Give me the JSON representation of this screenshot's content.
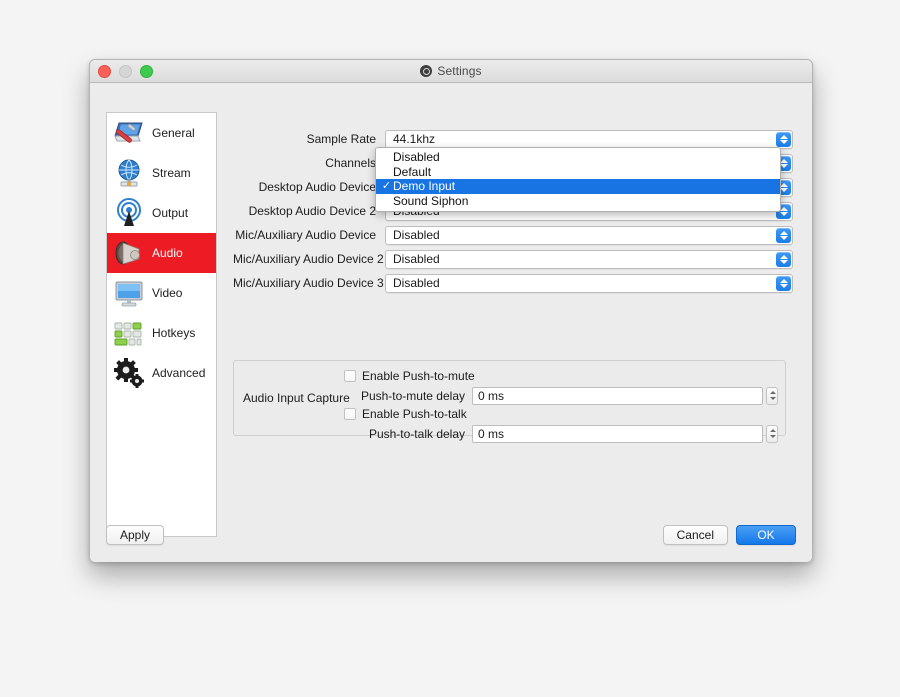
{
  "window": {
    "title": "Settings",
    "app_icon": "obs-icon",
    "traffic_lights": {
      "close": "close-button",
      "minimize": "minimize-button",
      "maximize": "maximize-button"
    }
  },
  "sidebar": {
    "items": [
      {
        "label": "General",
        "icon": "general-icon",
        "selected": false
      },
      {
        "label": "Stream",
        "icon": "stream-icon",
        "selected": false
      },
      {
        "label": "Output",
        "icon": "output-icon",
        "selected": false
      },
      {
        "label": "Audio",
        "icon": "audio-icon",
        "selected": true
      },
      {
        "label": "Video",
        "icon": "video-icon",
        "selected": false
      },
      {
        "label": "Hotkeys",
        "icon": "hotkeys-icon",
        "selected": false
      },
      {
        "label": "Advanced",
        "icon": "advanced-icon",
        "selected": false
      }
    ],
    "selected_color": "#ed1b24"
  },
  "form": {
    "rows": [
      {
        "label": "Sample Rate",
        "value": "44.1khz"
      },
      {
        "label": "Channels",
        "value": ""
      },
      {
        "label": "Desktop Audio Device",
        "value": ""
      },
      {
        "label": "Desktop Audio Device 2",
        "value": "Disabled"
      },
      {
        "label": "Mic/Auxiliary Audio Device",
        "value": "Disabled"
      },
      {
        "label": "Mic/Auxiliary Audio Device 2",
        "value": "Disabled"
      },
      {
        "label": "Mic/Auxiliary Audio Device 3",
        "value": "Disabled"
      }
    ]
  },
  "dropdown": {
    "open": true,
    "highlight_color": "#1874e2",
    "check_glyph": "✓",
    "options": [
      {
        "label": "Disabled",
        "checked": false,
        "selected": false
      },
      {
        "label": "Default",
        "checked": false,
        "selected": false
      },
      {
        "label": "Demo Input",
        "checked": true,
        "selected": true
      },
      {
        "label": "Sound Siphon",
        "checked": false,
        "selected": false
      }
    ]
  },
  "audio_input_capture": {
    "group_label": "Audio Input Capture",
    "push_to_mute": {
      "checkbox_label": "Enable Push-to-mute",
      "checked": false,
      "delay_label": "Push-to-mute delay",
      "delay_value": "0 ms"
    },
    "push_to_talk": {
      "checkbox_label": "Enable Push-to-talk",
      "checked": false,
      "delay_label": "Push-to-talk delay",
      "delay_value": "0 ms"
    }
  },
  "footer": {
    "apply_label": "Apply",
    "cancel_label": "Cancel",
    "ok_label": "OK",
    "ok_color": "#1478ea"
  }
}
